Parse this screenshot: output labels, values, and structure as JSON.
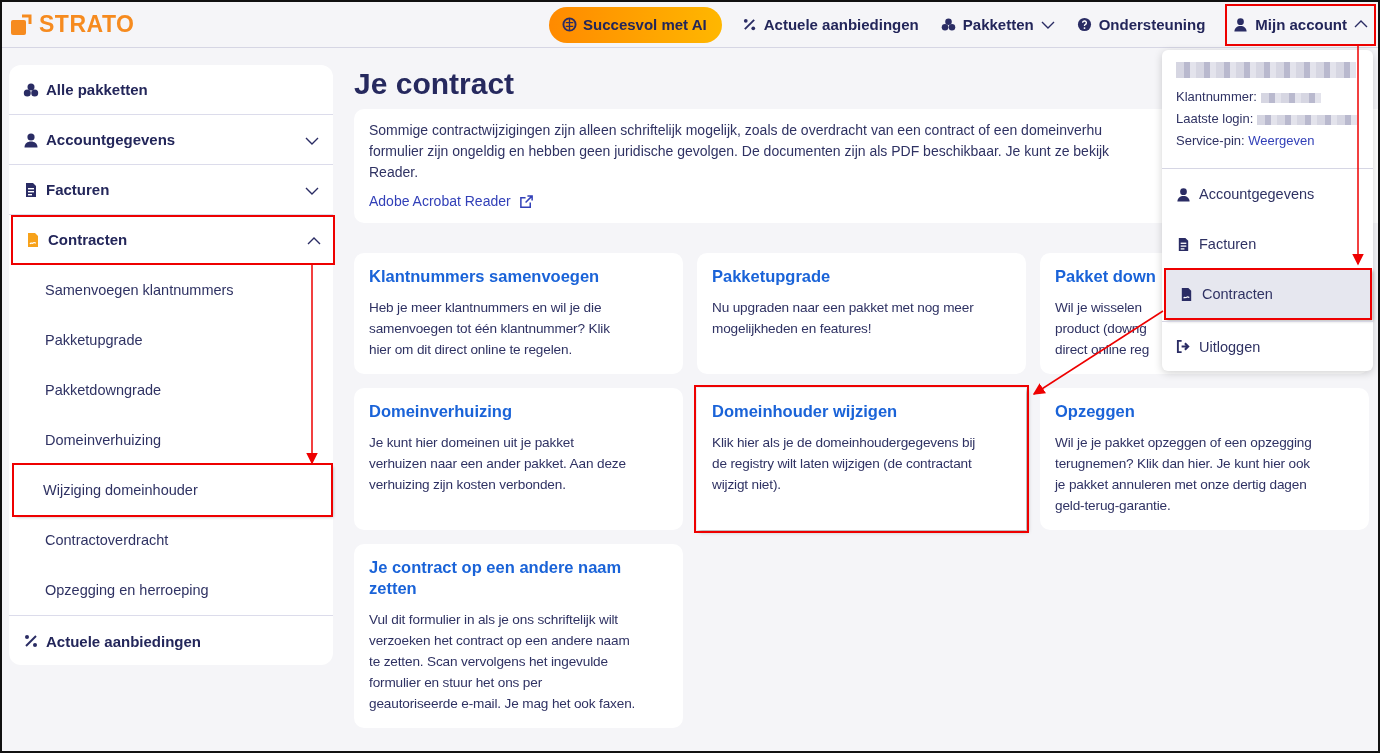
{
  "header": {
    "logo": "STRATO",
    "nav": [
      {
        "kind": "pill",
        "label": "Succesvol met AI"
      },
      {
        "kind": "link",
        "label": "Actuele aanbiedingen"
      },
      {
        "kind": "menu",
        "label": "Pakketten",
        "expanded": false,
        "highlighted": false
      },
      {
        "kind": "link",
        "label": "Ondersteuning"
      },
      {
        "kind": "menu",
        "label": "Mijn account",
        "expanded": true,
        "highlighted": true
      }
    ]
  },
  "sidebar": {
    "items": [
      {
        "label": "Alle pakketten",
        "active": false,
        "highlighted": false
      },
      {
        "label": "Accountgegevens",
        "expanded": false,
        "active": false,
        "highlighted": false
      },
      {
        "label": "Facturen",
        "expanded": false,
        "active": false,
        "highlighted": false
      },
      {
        "label": "Contracten",
        "expanded": true,
        "active": true,
        "highlighted": true,
        "children": [
          {
            "label": "Samenvoegen klantnummers",
            "highlighted": false
          },
          {
            "label": "Pakketupgrade",
            "highlighted": false
          },
          {
            "label": "Pakketdowngrade",
            "highlighted": false
          },
          {
            "label": "Domeinverhuizing",
            "highlighted": false
          },
          {
            "label": "Wijziging domeinhouder",
            "highlighted": true
          },
          {
            "label": "Contractoverdracht",
            "highlighted": false
          },
          {
            "label": "Opzegging en herroeping",
            "highlighted": false
          }
        ]
      },
      {
        "label": "Actuele aanbiedingen",
        "active": false,
        "highlighted": false
      }
    ]
  },
  "main": {
    "title": "Je contract",
    "intro": {
      "lines": [
        "Sommige contractwijzigingen zijn alleen schriftelijk mogelijk, zoals de overdracht van een contract of een domeinverhu",
        "formulier zijn ongeldig en hebben geen juridische gevolgen. De documenten zijn als PDF beschikbaar. Je kunt ze bekijk",
        "Reader."
      ],
      "link": "Adobe Acrobat Reader"
    },
    "cards": [
      {
        "title": "Klantnummers samenvoegen",
        "lines": [
          "Heb je meer klantnummers en wil je die",
          "samenvoegen tot één klantnummer? Klik",
          "hier om dit direct online te regelen."
        ],
        "highlighted": false
      },
      {
        "title": "Pakketupgrade",
        "lines": [
          "Nu upgraden naar een pakket met nog meer",
          "mogelijkheden en features!"
        ],
        "highlighted": false
      },
      {
        "title": "Pakket down",
        "lines": [
          "Wil je wisselen",
          "product (downg",
          "direct online reg"
        ],
        "highlighted": false
      },
      {
        "title": "Domeinverhuizing",
        "lines": [
          "Je kunt hier domeinen uit je pakket",
          "verhuizen naar een ander pakket. Aan deze",
          "verhuizing zijn kosten verbonden."
        ],
        "highlighted": false
      },
      {
        "title": "Domeinhouder wijzigen",
        "lines": [
          "Klik hier als je de domeinhoudergegevens bij",
          "de registry wilt laten wijzigen (de contractant",
          "wijzigt niet)."
        ],
        "highlighted": true
      },
      {
        "title": "Opzeggen",
        "lines": [
          "Wil je je pakket opzeggen of een opzegging",
          "terugnemen? Klik dan hier. Je kunt hier ook",
          "je pakket annuleren met onze dertig dagen",
          "geld-terug-garantie."
        ],
        "highlighted": false
      },
      {
        "title": "Je contract op een andere naam zetten",
        "lines": [
          "Vul dit formulier in als je ons schriftelijk wilt",
          "verzoeken het contract op een andere naam",
          "te zetten. Scan vervolgens het ingevulde",
          "formulier en stuur het ons per",
          "geautoriseerde e-mail. Je mag het ook faxen."
        ],
        "highlighted": false
      }
    ]
  },
  "account_menu": {
    "name_redacted": true,
    "info": [
      {
        "label": "Klantnummer:",
        "redacted": true
      },
      {
        "label": "Laatste login:",
        "redacted": true
      },
      {
        "label": "Service-pin:",
        "link": "Weergeven"
      }
    ],
    "items": [
      {
        "label": "Accountgegevens",
        "selected": false,
        "highlighted": false
      },
      {
        "label": "Facturen",
        "selected": false,
        "highlighted": false
      },
      {
        "label": "Contracten",
        "selected": true,
        "highlighted": true
      },
      {
        "label": "Uitloggen",
        "selected": false,
        "highlighted": false
      }
    ]
  }
}
